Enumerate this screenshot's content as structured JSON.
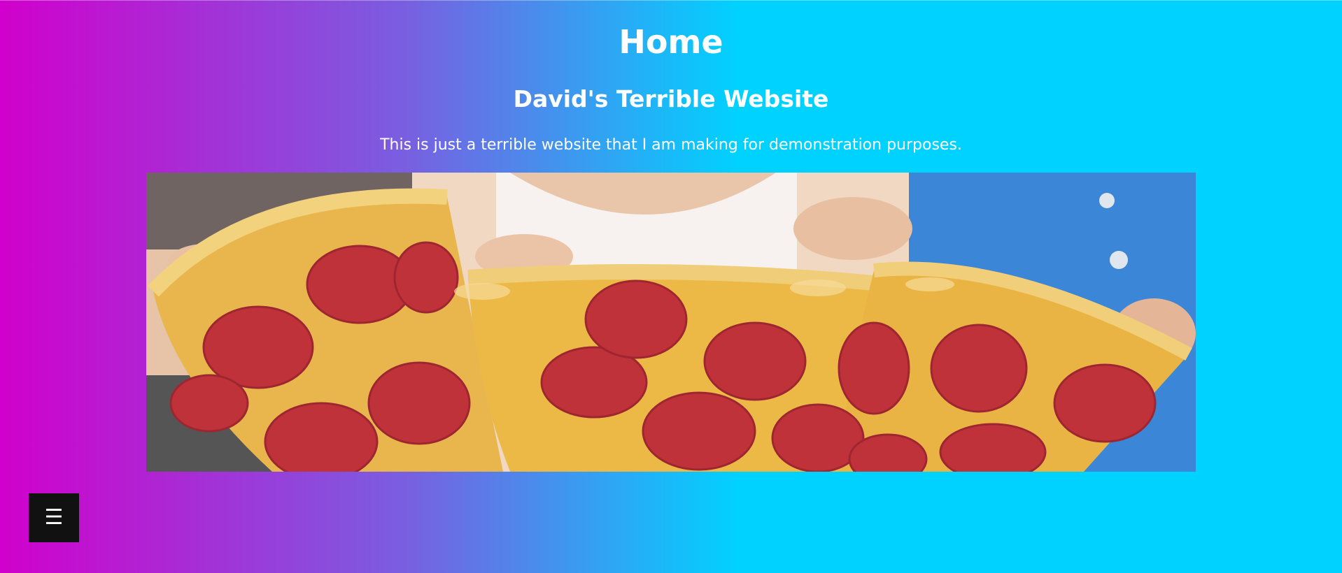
{
  "page": {
    "title": "Home",
    "site_title": "David's Terrible Website",
    "site_description": "This is just a terrible website that I am making for demonstration purposes."
  },
  "hero_image": {
    "alt": "",
    "icon": "pizza-photo"
  },
  "menu": {
    "icon": "hamburger-menu-icon",
    "glyph": "☰"
  },
  "colors": {
    "gradient_start": "#d100cc",
    "gradient_end": "#00d2ff",
    "menu_button": "#111111",
    "text": "#ffffff"
  }
}
